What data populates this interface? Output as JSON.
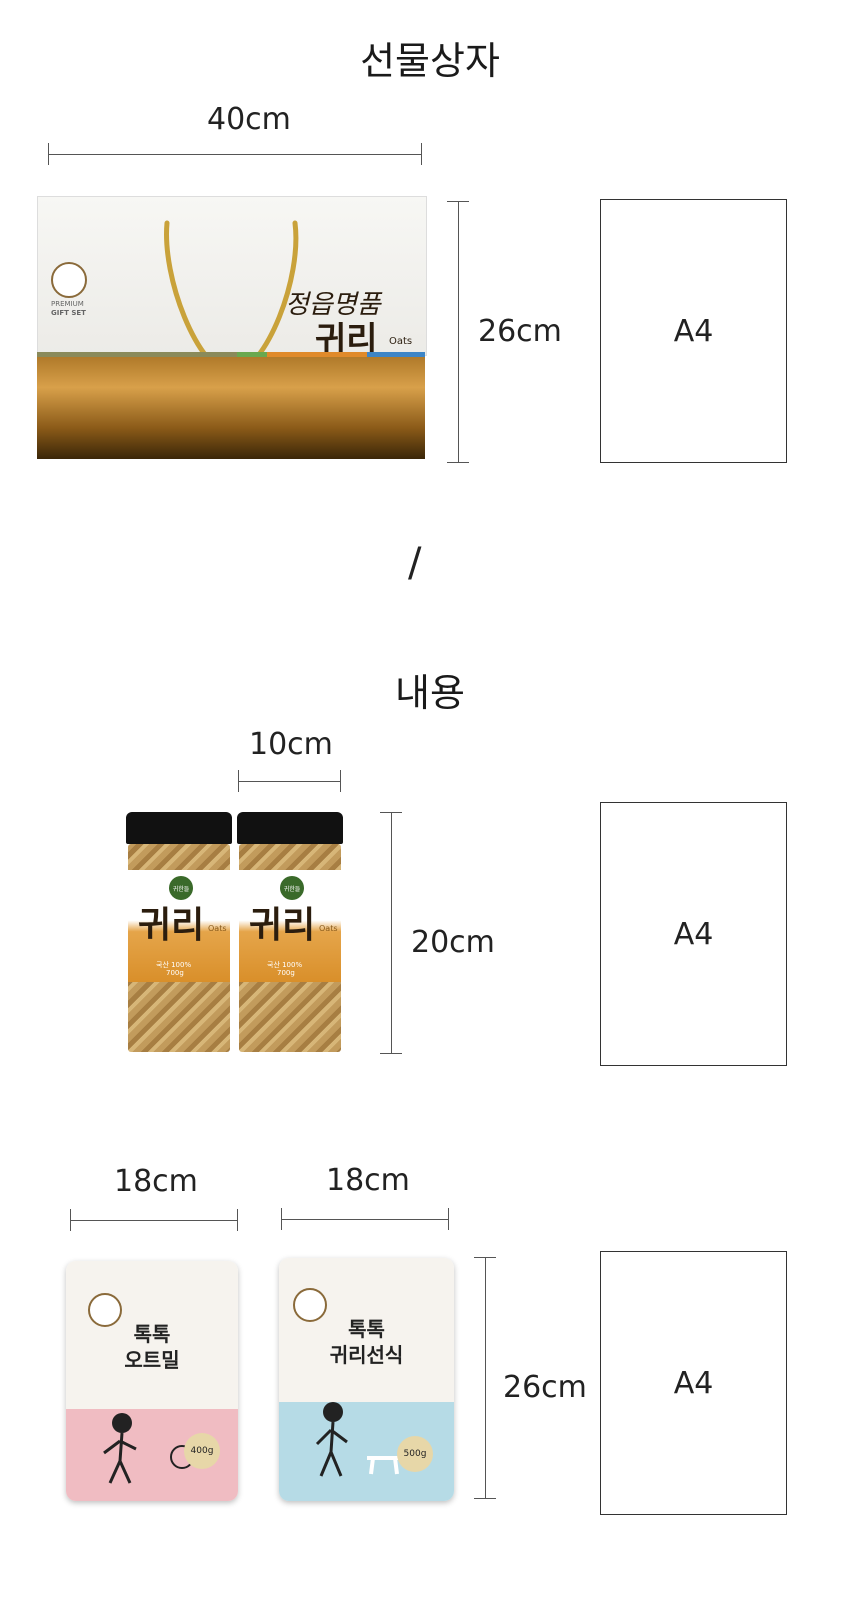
{
  "section1": {
    "title": "선물상자",
    "width_label": "40cm",
    "height_label": "26cm",
    "a4_label": "A4",
    "box": {
      "premium": "PREMIUM",
      "gift_set": "GIFT SET",
      "brand_line1": "정읍명품",
      "brand_line2": "귀리",
      "brand_en": "Oats"
    }
  },
  "divider": "/",
  "section2": {
    "title": "내용",
    "width_label": "10cm",
    "height_label": "20cm",
    "a4_label": "A4",
    "jar": {
      "badge": "귀한들",
      "name": "귀리",
      "name_en": "Oats",
      "tagline": "국산 100%",
      "weight": "700g"
    }
  },
  "section3": {
    "bag1_width_label": "18cm",
    "bag2_width_label": "18cm",
    "height_label": "26cm",
    "a4_label": "A4",
    "bag1": {
      "line1": "톡톡",
      "line2": "오트밀",
      "weight": "400g"
    },
    "bag2": {
      "line1": "톡톡",
      "line2": "귀리선식",
      "weight": "500g"
    }
  }
}
